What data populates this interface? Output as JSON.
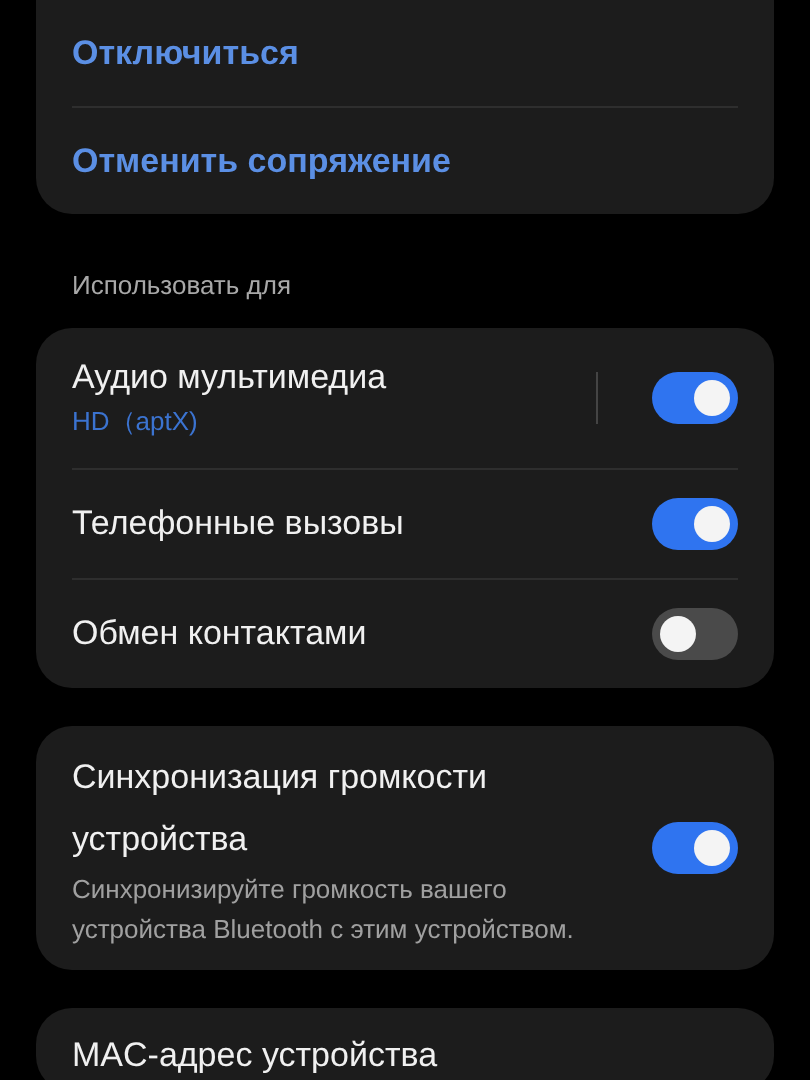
{
  "actions": [
    {
      "label": "Отключиться"
    },
    {
      "label": "Отменить сопряжение"
    }
  ],
  "section_title": "Использовать для",
  "profiles": [
    {
      "kind": "detail",
      "label": "Аудио мультимедиа",
      "sublabel": "HD（aptX)",
      "on": true
    },
    {
      "kind": "plain",
      "label": "Телефонные вызовы",
      "on": true
    },
    {
      "kind": "plain",
      "label": "Обмен контактами",
      "on": false
    }
  ],
  "volume_sync": {
    "title": "Синхронизация громкости устройства",
    "description": "Синхронизируйте громкость вашего устройства Bluetooth с этим устройством.",
    "on": true
  },
  "mac_address": {
    "title": "MAC-адрес устройства"
  }
}
